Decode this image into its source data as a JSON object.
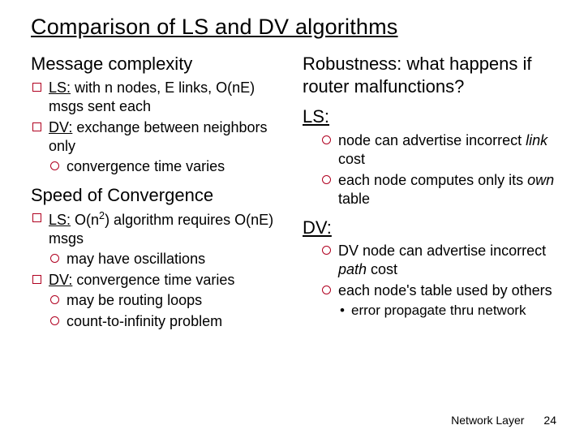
{
  "title": "Comparison of LS and DV algorithms",
  "left": {
    "h1": "Message complexity",
    "b1_pre": "LS:",
    "b1_post": " with n nodes, E links, O(nE) msgs sent each",
    "b2_pre": "DV:",
    "b2_post": " exchange between neighbors only",
    "b2_sub1": "convergence time varies",
    "h2": "Speed of Convergence",
    "b3_pre": "LS:",
    "b3_mid": " O(n",
    "b3_sup": "2",
    "b3_post": ") algorithm requires O(nE) msgs",
    "b3_sub1": "may have oscillations",
    "b4_pre": "DV:",
    "b4_post": " convergence time varies",
    "b4_sub1": "may be routing loops",
    "b4_sub2": "count-to-infinity problem"
  },
  "right": {
    "h1": "Robustness: what happens if router malfunctions?",
    "ls_head": "LS:",
    "ls_b1a": "node can advertise incorrect ",
    "ls_b1b": "link",
    "ls_b1c": " cost",
    "ls_b2a": "each node computes only its ",
    "ls_b2b": "own",
    "ls_b2c": " table",
    "dv_head": "DV:",
    "dv_b1a": "DV node can advertise incorrect ",
    "dv_b1b": "path",
    "dv_b1c": " cost",
    "dv_b2": "each node's table used by others",
    "dv_b2_sub1": "error propagate thru network"
  },
  "footer": {
    "label": "Network Layer",
    "page": "24"
  }
}
